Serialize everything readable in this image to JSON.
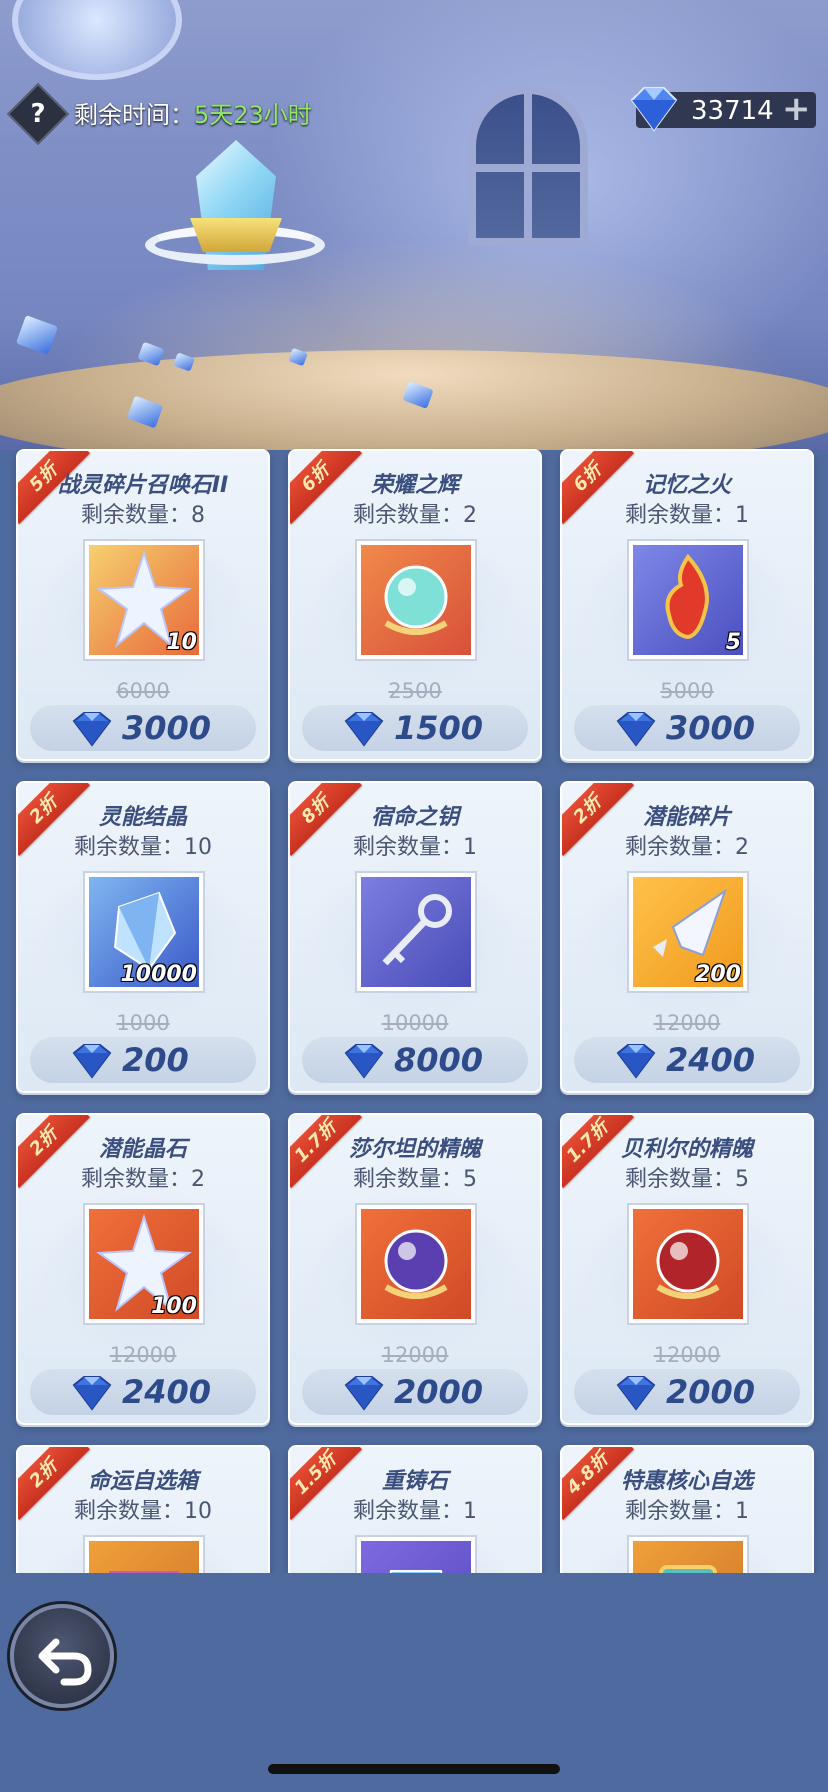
{
  "header": {
    "help_label": "?",
    "timer_label": "剩余时间：",
    "timer_value": "5天23小时",
    "currency_amount": "33714",
    "currency_plus": "+"
  },
  "stock_label": "剩余数量：",
  "items": [
    {
      "discount": "5折",
      "name": "战灵碎片召唤石II",
      "stock": "8",
      "qty": "10",
      "original": "6000",
      "price": "3000",
      "art": "star-shard",
      "art_colors": [
        "#f6d070",
        "#e86a3a"
      ]
    },
    {
      "discount": "6折",
      "name": "荣耀之辉",
      "stock": "2",
      "qty": "",
      "original": "2500",
      "price": "1500",
      "art": "orb",
      "art_colors": [
        "#f08a4a",
        "#d8503a"
      ]
    },
    {
      "discount": "6折",
      "name": "记忆之火",
      "stock": "1",
      "qty": "5",
      "original": "5000",
      "price": "3000",
      "art": "flame",
      "art_colors": [
        "#7e88e8",
        "#4b4fbf"
      ]
    },
    {
      "discount": "2折",
      "name": "灵能结晶",
      "stock": "10",
      "qty": "10000",
      "original": "1000",
      "price": "200",
      "art": "crystal",
      "art_colors": [
        "#7fb6f0",
        "#3a58c8"
      ]
    },
    {
      "discount": "8折",
      "name": "宿命之钥",
      "stock": "1",
      "qty": "",
      "original": "10000",
      "price": "8000",
      "art": "key",
      "art_colors": [
        "#7c7ee0",
        "#4a4cb8"
      ]
    },
    {
      "discount": "2折",
      "name": "潜能碎片",
      "stock": "2",
      "qty": "200",
      "original": "12000",
      "price": "2400",
      "art": "shard",
      "art_colors": [
        "#ffc24a",
        "#f09a1e"
      ]
    },
    {
      "discount": "2折",
      "name": "潜能晶石",
      "stock": "2",
      "qty": "100",
      "original": "12000",
      "price": "2400",
      "art": "star",
      "art_colors": [
        "#f0703a",
        "#d04a26"
      ]
    },
    {
      "discount": "1.7折",
      "name": "莎尔坦的精魄",
      "stock": "5",
      "qty": "",
      "original": "12000",
      "price": "2000",
      "art": "dark-orb",
      "art_colors": [
        "#f0703a",
        "#d04a26"
      ]
    },
    {
      "discount": "1.7折",
      "name": "贝利尔的精魄",
      "stock": "5",
      "qty": "",
      "original": "12000",
      "price": "2000",
      "art": "red-orb",
      "art_colors": [
        "#f0703a",
        "#d04a26"
      ]
    },
    {
      "discount": "2折",
      "name": "命运自选箱",
      "stock": "10",
      "qty": "",
      "original": "",
      "price": "",
      "art": "box",
      "art_colors": [
        "#f0a03a",
        "#d0762a"
      ]
    },
    {
      "discount": "1.5折",
      "name": "重铸石",
      "stock": "1",
      "qty": "",
      "original": "",
      "price": "",
      "art": "stone",
      "art_colors": [
        "#7e6ae0",
        "#5a4ac0"
      ]
    },
    {
      "discount": "4.8折",
      "name": "特惠核心自选",
      "stock": "1",
      "qty": "",
      "original": "",
      "price": "",
      "art": "core",
      "art_colors": [
        "#f0a03a",
        "#d0762a"
      ]
    }
  ],
  "icons": {
    "help": "help-icon",
    "currency": "diamond-icon",
    "back": "back-arrow-icon"
  },
  "colors": {
    "ribbon": "#d43b26",
    "timer_value": "#8eea5e",
    "price_text": "#2d4a8a",
    "name_text": "#3b4f7f"
  }
}
